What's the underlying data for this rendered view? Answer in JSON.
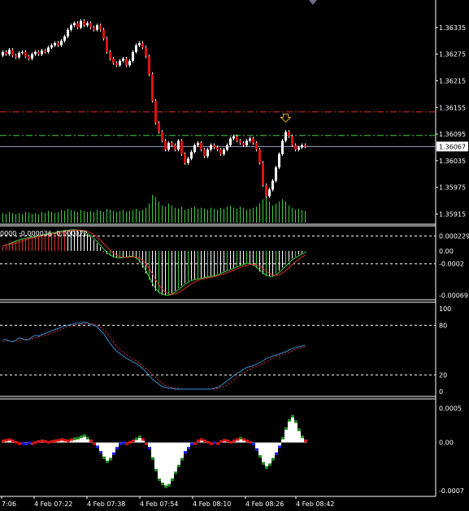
{
  "chart_data": [
    {
      "type": "candlestick",
      "title": "",
      "price_ticks": [
        "1.36335",
        "1.36275",
        "1.36215",
        "1.36155",
        "1.36095",
        "1.36035",
        "1.35975",
        "1.35915"
      ],
      "price_range": [
        1.35903,
        1.36375
      ],
      "current_price_label": "1.36067",
      "levels": [
        {
          "price": 1.36145,
          "style": "red-dashdot",
          "color": "#e03030"
        },
        {
          "price": 1.36092,
          "style": "green-dashdot",
          "color": "#3ecf3e"
        },
        {
          "price": 1.36067,
          "style": "solid",
          "color": "#9aa0c8"
        }
      ],
      "up_color": "#ffffff",
      "down_color": "#e01010",
      "closes": [
        1.3628,
        1.36275,
        1.36285,
        1.36272,
        1.36268,
        1.36278,
        1.3628,
        1.3627,
        1.36265,
        1.36275,
        1.3628,
        1.36275,
        1.36283,
        1.3628,
        1.3629,
        1.36295,
        1.363,
        1.36295,
        1.36305,
        1.36315,
        1.3633,
        1.3634,
        1.36345,
        1.36335,
        1.3635,
        1.3634,
        1.36345,
        1.36335,
        1.3633,
        1.3634,
        1.3633,
        1.3631,
        1.3628,
        1.36265,
        1.36255,
        1.3625,
        1.3626,
        1.36265,
        1.3625,
        1.3626,
        1.3628,
        1.36295,
        1.363,
        1.3629,
        1.3627,
        1.3623,
        1.3617,
        1.3612,
        1.361,
        1.3608,
        1.3606,
        1.36075,
        1.3607,
        1.3606,
        1.3608,
        1.3605,
        1.3603,
        1.3604,
        1.36055,
        1.3607,
        1.36075,
        1.3606,
        1.36045,
        1.3606,
        1.3607,
        1.36065,
        1.3606,
        1.3605,
        1.3606,
        1.3607,
        1.36085,
        1.3609,
        1.3608,
        1.36075,
        1.3607,
        1.3608,
        1.36085,
        1.36075,
        1.3606,
        1.3603,
        1.3598,
        1.35955,
        1.3597,
        1.3599,
        1.3602,
        1.3605,
        1.3608,
        1.361,
        1.3609,
        1.3607,
        1.3606,
        1.36065,
        1.3607,
        1.36067
      ],
      "volumes": [
        9,
        8,
        10,
        9,
        8,
        9,
        8,
        10,
        9,
        8,
        9,
        8,
        10,
        9,
        11,
        10,
        9,
        10,
        12,
        11,
        13,
        12,
        11,
        10,
        12,
        11,
        10,
        11,
        10,
        12,
        11,
        10,
        13,
        12,
        11,
        10,
        11,
        12,
        10,
        11,
        12,
        13,
        11,
        12,
        14,
        18,
        26,
        24,
        20,
        16,
        15,
        18,
        16,
        14,
        13,
        15,
        12,
        13,
        14,
        15,
        13,
        14,
        13,
        12,
        14,
        13,
        12,
        14,
        13,
        15,
        16,
        14,
        13,
        15,
        14,
        12,
        13,
        14,
        15,
        18,
        22,
        24,
        20,
        16,
        18,
        20,
        22,
        20,
        16,
        14,
        12,
        13,
        12,
        11
      ],
      "signal_arrow": {
        "index": 87,
        "color": "#e0b020"
      }
    },
    {
      "type": "macd",
      "header": "0000  -0.000036  -0.000022",
      "y_ticks": [
        "0.000229",
        "0.00",
        "-0.0002",
        "-0.00069"
      ],
      "y_range": [
        -0.00072,
        0.00035
      ],
      "dashed_levels": [
        0.00023,
        -0.0002
      ],
      "histogram": [
        8e-05,
        0.0001,
        0.00012,
        0.00014,
        0.00016,
        0.00018,
        0.00019,
        0.0002,
        0.00021,
        0.00022,
        0.00023,
        0.00024,
        0.00025,
        0.00026,
        0.00027,
        0.00028,
        0.00029,
        0.0003,
        0.00031,
        0.00032,
        0.00032,
        0.00033,
        0.00033,
        0.00032,
        0.00031,
        0.00029,
        0.00026,
        0.00022,
        0.00017,
        0.00012,
        6e-05,
        0.0,
        -5e-05,
        -8e-05,
        -0.0001,
        -0.00011,
        -0.00011,
        -0.0001,
        -9e-05,
        -8e-05,
        -9e-05,
        -0.00012,
        -0.00018,
        -0.00026,
        -0.00035,
        -0.00045,
        -0.00055,
        -0.00062,
        -0.00066,
        -0.00068,
        -0.00069,
        -0.00068,
        -0.00066,
        -0.00062,
        -0.00058,
        -0.00054,
        -0.0005,
        -0.00047,
        -0.00045,
        -0.00044,
        -0.00043,
        -0.00042,
        -0.00041,
        -0.0004,
        -0.00039,
        -0.00038,
        -0.00036,
        -0.00034,
        -0.00032,
        -0.0003,
        -0.00028,
        -0.00026,
        -0.00024,
        -0.00022,
        -0.0002,
        -0.00019,
        -0.0002,
        -0.00023,
        -0.00027,
        -0.00032,
        -0.00036,
        -0.00039,
        -0.0004,
        -0.00039,
        -0.00036,
        -0.00031,
        -0.00026,
        -0.00021,
        -0.00016,
        -0.00012,
        -9e-05,
        -6e-05,
        -4e-05,
        -2e-05
      ],
      "main_color": "#3ecf3e",
      "signal_color": "#e03030"
    },
    {
      "type": "stochastic",
      "y_ticks": [
        "100",
        "80",
        "20",
        "0"
      ],
      "y_range": [
        0,
        100
      ],
      "dashed_levels": [
        80,
        20
      ],
      "main": [
        62,
        63,
        61,
        60,
        62,
        65,
        64,
        62,
        63,
        66,
        68,
        67,
        69,
        70,
        72,
        73,
        75,
        76,
        78,
        79,
        80,
        81,
        82,
        83,
        82,
        84,
        83,
        81,
        80,
        78,
        74,
        70,
        64,
        58,
        53,
        49,
        46,
        43,
        40,
        38,
        36,
        34,
        31,
        28,
        24,
        20,
        15,
        12,
        9,
        6,
        5,
        4,
        4,
        3,
        3,
        3,
        3,
        3,
        3,
        3,
        3,
        3,
        3,
        3,
        3,
        4,
        5,
        7,
        10,
        13,
        16,
        19,
        22,
        24,
        27,
        29,
        30,
        31,
        33,
        35,
        37,
        40,
        41,
        43,
        44,
        45,
        47,
        48,
        50,
        52,
        53,
        54,
        55,
        56
      ],
      "signal": [
        60,
        61,
        61,
        61,
        61,
        62,
        63,
        63,
        63,
        64,
        65,
        66,
        67,
        68,
        69,
        71,
        72,
        74,
        75,
        77,
        78,
        79,
        80,
        81,
        81,
        82,
        82,
        82,
        81,
        80,
        78,
        75,
        71,
        66,
        60,
        55,
        51,
        47,
        44,
        41,
        39,
        37,
        34,
        31,
        28,
        25,
        21,
        17,
        13,
        10,
        7,
        6,
        5,
        4,
        4,
        3,
        3,
        3,
        3,
        3,
        3,
        3,
        3,
        3,
        3,
        3,
        4,
        5,
        6,
        8,
        11,
        14,
        17,
        20,
        22,
        25,
        27,
        29,
        30,
        32,
        34,
        36,
        38,
        40,
        42,
        43,
        45,
        46,
        47,
        49,
        51,
        52,
        53,
        54
      ],
      "main_color": "#3a8fd0",
      "signal_color": "#e03030"
    },
    {
      "type": "histogram",
      "y_ticks": [
        "0.0005",
        "0.00",
        "-0.0007"
      ],
      "y_range": [
        -0.00075,
        0.0006
      ],
      "values": [
        4e-05,
        5e-05,
        6e-05,
        4e-05,
        2e-05,
        0.0,
        -3e-05,
        -4e-05,
        -2e-05,
        0.0,
        2e-05,
        3e-05,
        4e-05,
        3e-05,
        2e-05,
        3e-05,
        4e-05,
        5e-05,
        6e-05,
        5e-05,
        4e-05,
        6e-05,
        7e-05,
        8e-05,
        0.0001,
        0.00012,
        8e-05,
        4e-05,
        0.0,
        -8e-05,
        -0.00016,
        -0.00024,
        -0.0003,
        -0.00026,
        -0.00018,
        -0.0001,
        -4e-05,
        -2e-05,
        0.0,
        2e-05,
        4e-05,
        7e-05,
        0.0001,
        6e-05,
        0.0,
        -0.0001,
        -0.00025,
        -0.00042,
        -0.00056,
        -0.00062,
        -0.00066,
        -0.00064,
        -0.00056,
        -0.00046,
        -0.00036,
        -0.00026,
        -0.00016,
        -0.0001,
        -4e-05,
        0.0,
        4e-05,
        6e-05,
        4e-05,
        2e-05,
        0.0,
        -2e-05,
        0.0,
        3e-05,
        5e-05,
        4e-05,
        2e-05,
        4e-05,
        6e-05,
        8e-05,
        6e-05,
        4e-05,
        2e-05,
        -4e-05,
        -0.00012,
        -0.00022,
        -0.00032,
        -0.00038,
        -0.00034,
        -0.00026,
        -0.00018,
        -8e-05,
        8e-05,
        0.00022,
        0.00034,
        0.0004,
        0.00032,
        0.0002,
        0.0001,
        4e-05
      ],
      "colors": {
        "up": "#ffffff",
        "down": "#ffffff",
        "green": "#1a8a1a",
        "blue": "#1a1af0",
        "red": "#e01010"
      }
    }
  ],
  "time_axis": {
    "labels": [
      "7:06",
      "4 Feb 07:22",
      "4 Feb 07:38",
      "4 Feb 07:54",
      "4 Feb 08:10",
      "4 Feb 08:26",
      "4 Feb 08:42"
    ]
  }
}
